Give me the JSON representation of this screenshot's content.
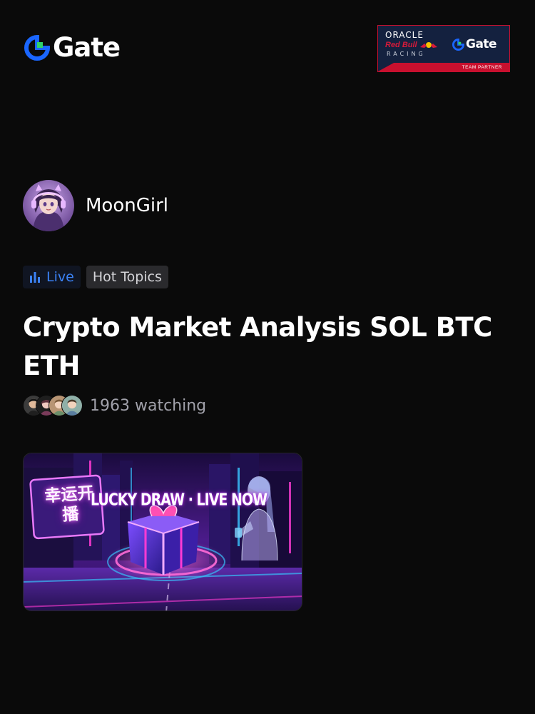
{
  "header": {
    "logo_text": "Gate",
    "logo_color": "#1a66ff",
    "partner": {
      "oracle": "ORACLE",
      "red_bull": "Red Bull",
      "racing": "RACING",
      "gate": "Gate",
      "strip": "TEAM PARTNER"
    }
  },
  "host": {
    "name": "MoonGirl",
    "avatar_icon": "anime-girl-avatar"
  },
  "tags": {
    "live_label": "Live",
    "live_color": "#3b82f6",
    "topic_label": "Hot Topics"
  },
  "stream": {
    "title": "Crypto Market Analysis SOL BTC ETH",
    "watching_text": "1963 watching",
    "viewer_count_avatars": 4
  },
  "banner": {
    "headline": "LUCKY DRAW · LIVE NOW",
    "sign_text": "幸运开播"
  }
}
